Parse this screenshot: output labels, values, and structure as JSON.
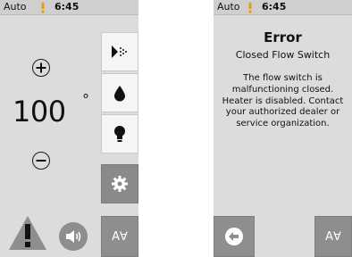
{
  "left_screen": {
    "status": {
      "mode": "Auto",
      "alert_icon": "exclamation-icon",
      "time": "6:45"
    },
    "temperature": {
      "value": "100",
      "unit": "°"
    },
    "controls": {
      "increase": "plus-circle-icon",
      "decrease": "minus-circle-icon"
    },
    "sidebar": [
      {
        "icon": "spray-jet-icon"
      },
      {
        "icon": "water-drop-icon"
      },
      {
        "icon": "light-bulb-icon"
      },
      {
        "icon": "gear-icon"
      }
    ],
    "bottom": {
      "warning_icon": "warning-triangle-icon",
      "sound_icon": "speaker-icon",
      "text_size_label": "A∀"
    }
  },
  "right_screen": {
    "status": {
      "mode": "Auto",
      "alert_icon": "exclamation-icon",
      "time": "6:45"
    },
    "error": {
      "title": "Error",
      "subtitle": "Closed Flow Switch",
      "message_lines": [
        "The flow switch is",
        "malfunctioning closed.",
        "Heater is disabled. Contact",
        "your authorized dealer or",
        "service organization."
      ]
    },
    "bottom": {
      "back_icon": "back-arrow-icon",
      "text_size_label": "A∀"
    }
  },
  "colors": {
    "screen_bg": "#dcdcdc",
    "status_bar": "#cfcfcf",
    "button_light": "#f5f5f5",
    "button_dark": "#8e8e8e",
    "alert_orange": "#f0a000"
  }
}
